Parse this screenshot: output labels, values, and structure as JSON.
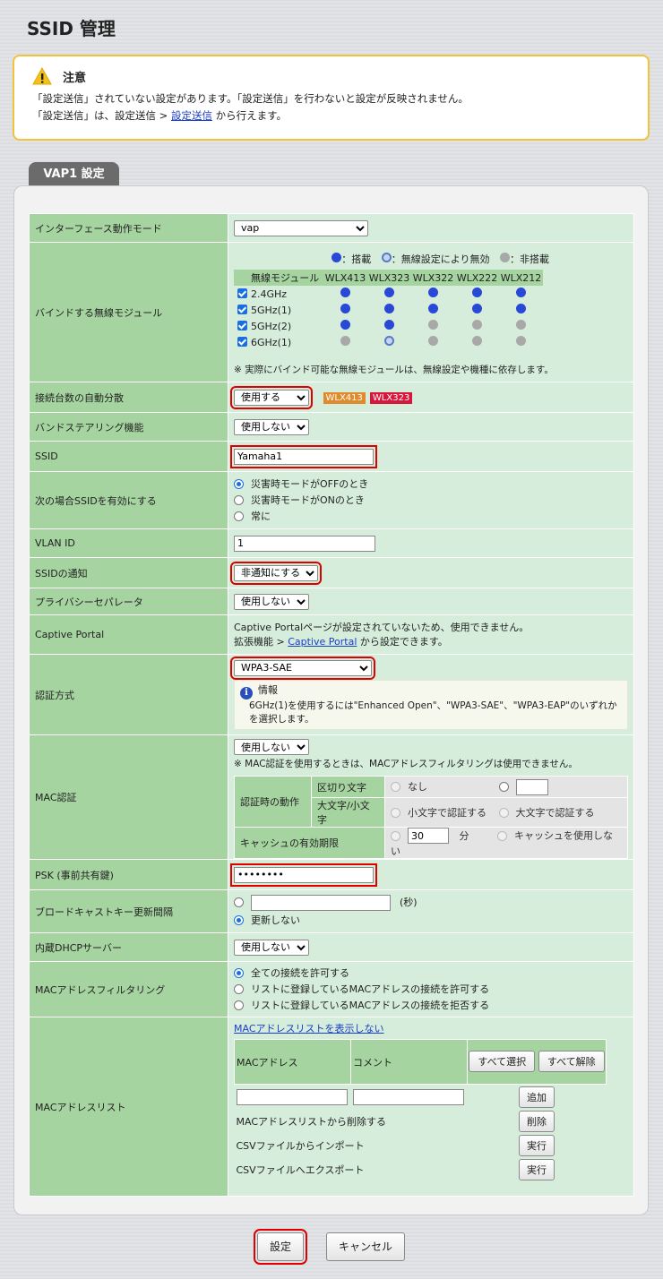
{
  "page_title": "SSID 管理",
  "notice": {
    "title": "注意",
    "line1": "「設定送信」されていない設定があります。「設定送信」を行わないと設定が反映されません。",
    "line2_prefix": "「設定送信」は、設定送信 > ",
    "line2_link": "設定送信",
    "line2_suffix": " から行えます。"
  },
  "tab_label": "VAP1 設定",
  "rows": {
    "iface_mode": {
      "label": "インターフェース動作モード",
      "value": "vap"
    },
    "bind_module": {
      "label": "バインドする無線モジュール",
      "legend_on": "：搭載",
      "legend_disabled": "：無線設定により無効",
      "legend_none": "：非搭載",
      "header_module": "無線モジュール",
      "models": [
        "WLX413",
        "WLX323",
        "WLX322",
        "WLX222",
        "WLX212"
      ],
      "bands": [
        {
          "name": "2.4GHz",
          "states": [
            "b",
            "b",
            "b",
            "b",
            "b"
          ]
        },
        {
          "name": "5GHz(1)",
          "states": [
            "b",
            "b",
            "b",
            "b",
            "b"
          ]
        },
        {
          "name": "5GHz(2)",
          "states": [
            "b",
            "b",
            "g",
            "g",
            "g"
          ]
        },
        {
          "name": "6GHz(1)",
          "states": [
            "g",
            "o",
            "g",
            "g",
            "g"
          ]
        }
      ],
      "note": "※ 実際にバインド可能な無線モジュールは、無線設定や機種に依存します。"
    },
    "auto_dist": {
      "label": "接続台数の自動分散",
      "value": "使用する",
      "badge1": "WLX413",
      "badge1_color": "#e08a2c",
      "badge2": "WLX323",
      "badge2_color": "#d8173d"
    },
    "band_steering": {
      "label": "バンドステアリング機能",
      "value": "使用しない"
    },
    "ssid": {
      "label": "SSID",
      "value": "Yamaha1"
    },
    "ssid_enable": {
      "label": "次の場合SSIDを有効にする",
      "opt1": "災害時モードがOFFのとき",
      "opt2": "災害時モードがONのとき",
      "opt3": "常に"
    },
    "vlan": {
      "label": "VLAN ID",
      "value": "1"
    },
    "ssid_notify": {
      "label": "SSIDの通知",
      "value": "非通知にする"
    },
    "privacy": {
      "label": "プライバシーセパレータ",
      "value": "使用しない"
    },
    "captive": {
      "label": "Captive Portal",
      "line1": "Captive Portalページが設定されていないため、使用できません。",
      "line2_prefix": "拡張機能 > ",
      "line2_link": "Captive Portal",
      "line2_suffix": " から設定できます。"
    },
    "auth": {
      "label": "認証方式",
      "value": "WPA3-SAE",
      "info_title": "情報",
      "info_line1": "6GHz(1)を使用するには\"Enhanced Open\"、\"WPA3-SAE\"、\"WPA3-EAP\"のいずれか",
      "info_line2": "を選択します。"
    },
    "mac_auth": {
      "label": "MAC認証",
      "value": "使用しない",
      "note": "※ MAC認証を使用するときは、MACアドレスフィルタリングは使用できません。",
      "auth_action": "認証時の動作",
      "delimiter": "区切り文字",
      "delim_none": "なし",
      "case": "大文字/小文字",
      "case_lower": "小文字で認証する",
      "case_upper": "大文字で認証する",
      "cache": "キャッシュの有効期限",
      "cache_value": "30",
      "cache_unit": "分",
      "cache_none": "キャッシュを使用しない"
    },
    "psk": {
      "label": "PSK (事前共有鍵)",
      "value": "••••••••"
    },
    "broadcast": {
      "label": "ブロードキャストキー更新間隔",
      "unit": "(秒)",
      "opt_no": "更新しない"
    },
    "dhcp": {
      "label": "内蔵DHCPサーバー",
      "value": "使用しない"
    },
    "mac_filter": {
      "label": "MACアドレスフィルタリング",
      "opt1": "全ての接続を許可する",
      "opt2": "リストに登録しているMACアドレスの接続を許可する",
      "opt3": "リストに登録しているMACアドレスの接続を拒否する"
    },
    "mac_list": {
      "label": "MACアドレスリスト",
      "toggle_link": "MACアドレスリストを表示しない",
      "col_mac": "MACアドレス",
      "col_comment": "コメント",
      "select_all": "すべて選択",
      "deselect_all": "すべて解除",
      "add": "追加",
      "delete_label": "MACアドレスリストから削除する",
      "delete": "削除",
      "import_label": "CSVファイルからインポート",
      "import": "実行",
      "export_label": "CSVファイルへエクスポート",
      "export": "実行"
    }
  },
  "buttons": {
    "submit": "設定",
    "cancel": "キャンセル"
  }
}
